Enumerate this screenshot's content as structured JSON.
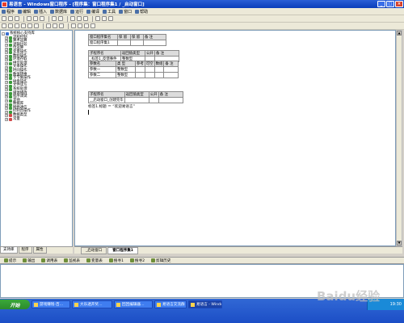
{
  "window": {
    "title": "易语言 - Windows窗口程序 - [程序集：窗口程序集1 / _启动窗口]"
  },
  "menu": [
    "程序",
    "编辑",
    "插入",
    "数据库",
    "运行",
    "编译",
    "工具",
    "窗口",
    "帮助"
  ],
  "tree": [
    {
      "label": "系统核心支持库",
      "indent": 0,
      "expand": "-",
      "color": "#3a6fd0"
    },
    {
      "label": "流程控制",
      "indent": 1,
      "expand": "+",
      "color": "#3a9a3a"
    },
    {
      "label": "算术运算",
      "indent": 1,
      "expand": "+",
      "color": "#3a9a3a"
    },
    {
      "label": "逻辑比较",
      "indent": 1,
      "expand": "+",
      "color": "#3a9a3a"
    },
    {
      "label": "位运算",
      "indent": 1,
      "expand": "+",
      "color": "#3a9a3a"
    },
    {
      "label": "变量操作",
      "indent": 1,
      "expand": "+",
      "color": "#3a9a3a"
    },
    {
      "label": "数组操作",
      "indent": 1,
      "expand": "+",
      "color": "#3a9a3a"
    },
    {
      "label": "环境存取",
      "indent": 1,
      "expand": "+",
      "color": "#3a9a3a"
    },
    {
      "label": "拼音处理",
      "indent": 1,
      "expand": "+",
      "color": "#3a9a3a"
    },
    {
      "label": "文本操作",
      "indent": 1,
      "expand": "+",
      "color": "#3a9a3a"
    },
    {
      "label": "时间操作",
      "indent": 1,
      "expand": "+",
      "color": "#3a9a3a"
    },
    {
      "label": "数值转换",
      "indent": 1,
      "expand": "+",
      "color": "#3a9a3a"
    },
    {
      "label": "字节集操作",
      "indent": 1,
      "expand": "+",
      "color": "#3a9a3a"
    },
    {
      "label": "磁盘操作",
      "indent": 1,
      "expand": "+",
      "color": "#3a9a3a"
    },
    {
      "label": "文件读写",
      "indent": 1,
      "expand": "+",
      "color": "#3a9a3a"
    },
    {
      "label": "系统处理",
      "indent": 1,
      "expand": "+",
      "color": "#3a9a3a"
    },
    {
      "label": "媒体播放",
      "indent": 1,
      "expand": "+",
      "color": "#3a9a3a"
    },
    {
      "label": "程序调试",
      "indent": 1,
      "expand": "+",
      "color": "#3a9a3a"
    },
    {
      "label": "其他",
      "indent": 1,
      "expand": "+",
      "color": "#3a9a3a"
    },
    {
      "label": "数据库",
      "indent": 1,
      "expand": "+",
      "color": "#3a9a3a"
    },
    {
      "label": "网络通信",
      "indent": 1,
      "expand": "+",
      "color": "#3a9a3a"
    },
    {
      "label": "控制台操作",
      "indent": 1,
      "expand": "+",
      "color": "#3a9a3a"
    },
    {
      "label": "数据类型",
      "indent": 1,
      "expand": "+",
      "color": "#d04a4a"
    },
    {
      "label": "常量",
      "indent": 1,
      "expand": "+",
      "color": "#d04a4a"
    }
  ],
  "left_tabs": [
    "支持库",
    "程序",
    "属性"
  ],
  "editor": {
    "assembly_table": [
      [
        "窗口程序集名",
        "保 留",
        "保 留",
        "备 注"
      ],
      [
        "窗口程序集1",
        "",
        "",
        ""
      ]
    ],
    "sub1_header": [
      [
        "子程序名",
        "返回值类型",
        "公开",
        "备 注"
      ],
      [
        "_标签1_反馈事件",
        "整数型",
        "",
        ""
      ]
    ],
    "sub1_params": [
      [
        "参数名",
        "类 型",
        "参考",
        "可空",
        "数组",
        "备 注"
      ],
      [
        "参数一",
        "整数型",
        "",
        "",
        "",
        ""
      ],
      [
        "参数二",
        "整数型",
        "",
        "",
        "",
        ""
      ]
    ],
    "sub2_header": [
      [
        "子程序名",
        "返回值类型",
        "公开",
        "备 注"
      ],
      [
        "__启动窗口_创建完毕",
        "",
        "",
        ""
      ]
    ],
    "code_line": "标签1.标题 ＝ “欢迎易语言”"
  },
  "editor_tabs": [
    "_启动窗口",
    "窗口程序集1"
  ],
  "bottom_tabs": [
    "提示",
    "输出",
    "调用表",
    "监视表",
    "变量表",
    "搜寻1",
    "搜寻2",
    "剪辑历史"
  ],
  "taskbar": {
    "start": "开始",
    "tasks": [
      "游戏赚钱-百…",
      "大乐透开奖…",
      "回回编辑器…",
      "易语言交流群",
      "易语言 - Windows…"
    ],
    "clock": "19:30"
  },
  "watermark": "Baidu经验"
}
